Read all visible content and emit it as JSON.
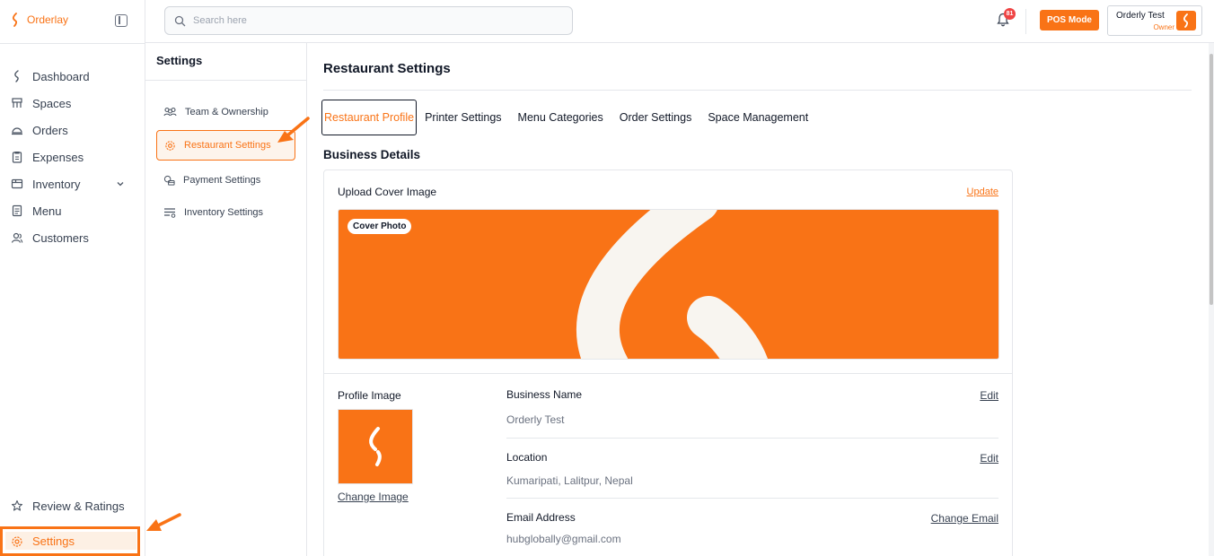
{
  "app": {
    "name": "Orderlay"
  },
  "sidebar": {
    "items": [
      {
        "label": "Dashboard",
        "icon": "orderlay-logo-icon"
      },
      {
        "label": "Spaces",
        "icon": "spaces-icon"
      },
      {
        "label": "Orders",
        "icon": "cloche-icon"
      },
      {
        "label": "Expenses",
        "icon": "clipboard-icon"
      },
      {
        "label": "Inventory",
        "icon": "inventory-icon",
        "expandable": true
      },
      {
        "label": "Menu",
        "icon": "menu-icon"
      },
      {
        "label": "Customers",
        "icon": "users-icon"
      }
    ],
    "bottom": {
      "review_label": "Review & Ratings",
      "settings_label": "Settings"
    }
  },
  "topbar": {
    "search_placeholder": "Search here",
    "notification_count": "81",
    "pos_mode_label": "POS Mode",
    "user_name": "Orderly Test",
    "user_role": "Owner"
  },
  "settings_nav": {
    "title": "Settings",
    "items": [
      {
        "label": "Team & Ownership",
        "icon": "team-icon",
        "active": false
      },
      {
        "label": "Restaurant Settings",
        "icon": "gear-icon",
        "active": true
      },
      {
        "label": "Payment Settings",
        "icon": "payment-icon",
        "active": false
      },
      {
        "label": "Inventory Settings",
        "icon": "inventory-settings-icon",
        "active": false
      }
    ]
  },
  "main": {
    "title": "Restaurant Settings",
    "tabs": [
      {
        "label": "Restaurant Profile",
        "active": true
      },
      {
        "label": "Printer Settings",
        "active": false
      },
      {
        "label": "Menu Categories",
        "active": false
      },
      {
        "label": "Order Settings",
        "active": false
      },
      {
        "label": "Space Management",
        "active": false
      }
    ],
    "section_title": "Business Details",
    "cover": {
      "label": "Upload Cover Image",
      "update_label": "Update",
      "badge": "Cover Photo"
    },
    "profile": {
      "label": "Profile Image",
      "change_label": "Change Image"
    },
    "fields": {
      "business_name": {
        "label": "Business Name",
        "value": "Orderly Test",
        "action": "Edit"
      },
      "location": {
        "label": "Location",
        "value": "Kumaripati, Lalitpur, Nepal",
        "action": "Edit"
      },
      "email": {
        "label": "Email Address",
        "value": "hubglobally@gmail.com",
        "action": "Change Email"
      }
    }
  },
  "colors": {
    "accent": "#f97316",
    "text": "#111827",
    "muted": "#6b7280",
    "border": "#e5e7eb"
  }
}
